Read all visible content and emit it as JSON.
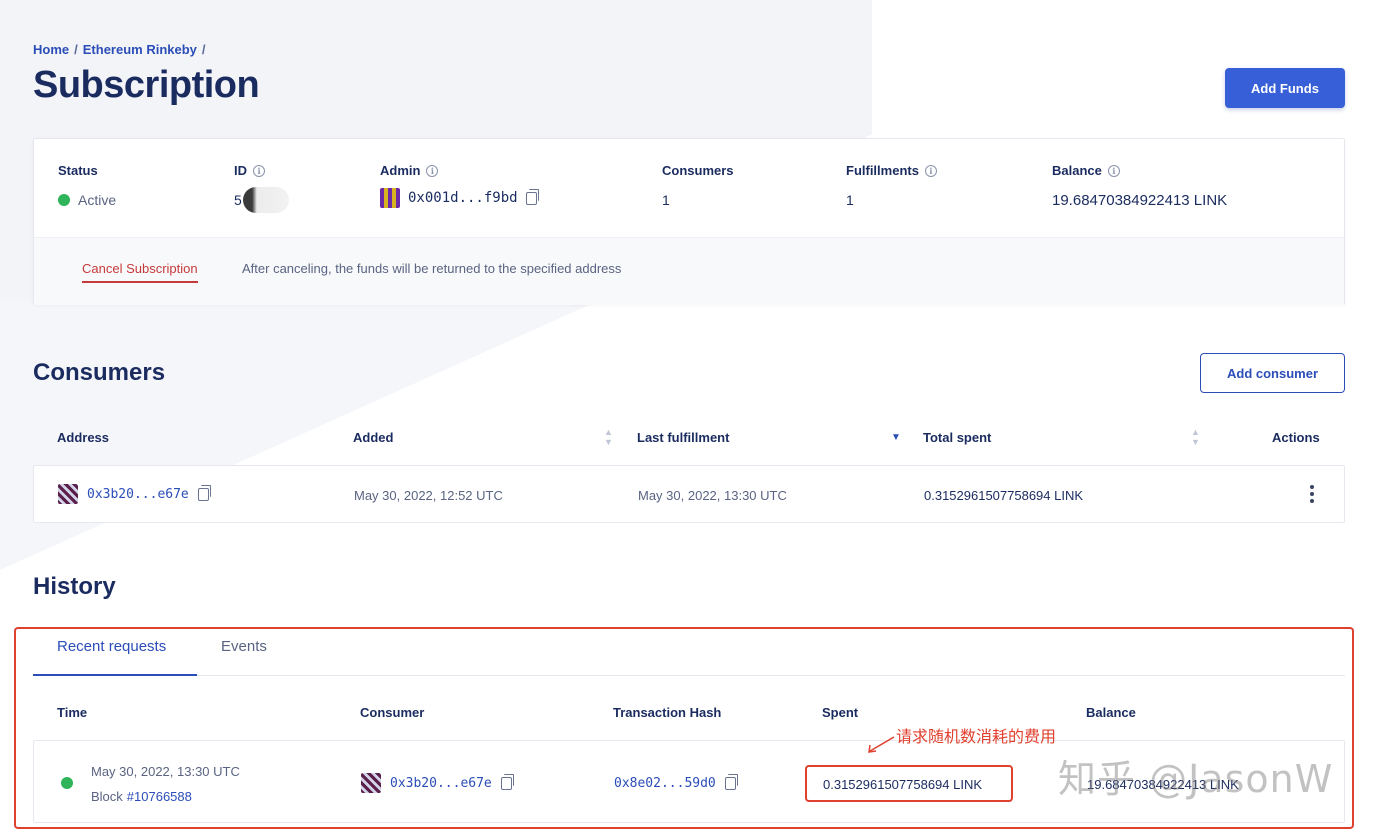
{
  "breadcrumb": {
    "home": "Home",
    "sep1": "/",
    "network": "Ethereum Rinkeby",
    "sep2": "/"
  },
  "page": {
    "title": "Subscription",
    "add_funds_label": "Add Funds"
  },
  "summary": {
    "status_label": "Status",
    "status_value": "Active",
    "id_label": "ID",
    "id_value": "5",
    "admin_label": "Admin",
    "admin_value": "0x001d...f9bd",
    "consumers_label": "Consumers",
    "consumers_value": "1",
    "fulfillments_label": "Fulfillments",
    "fulfillments_value": "1",
    "balance_label": "Balance",
    "balance_value": "19.68470384922413 LINK",
    "info_glyph": "i"
  },
  "cancel": {
    "label": "Cancel Subscription",
    "note": "After canceling, the funds will be returned to the specified address"
  },
  "consumers": {
    "title": "Consumers",
    "add_label": "Add consumer",
    "headers": {
      "address": "Address",
      "added": "Added",
      "last_fulfillment": "Last fulfillment",
      "total_spent": "Total spent",
      "actions": "Actions"
    },
    "rows": [
      {
        "address": "0x3b20...e67e",
        "added": "May 30, 2022, 12:52 UTC",
        "last_fulfillment": "May 30, 2022, 13:30 UTC",
        "total_spent": "0.3152961507758694 LINK"
      }
    ]
  },
  "history": {
    "title": "History",
    "tabs": {
      "recent": "Recent requests",
      "events": "Events"
    },
    "headers": {
      "time": "Time",
      "consumer": "Consumer",
      "tx_hash": "Transaction Hash",
      "spent": "Spent",
      "balance": "Balance"
    },
    "rows": [
      {
        "time": "May 30, 2022, 13:30 UTC",
        "block_label": "Block",
        "block": "#10766588",
        "consumer": "0x3b20...e67e",
        "tx_hash": "0x8e02...59d0",
        "spent": "0.3152961507758694 LINK",
        "balance": "19.68470384922413 LINK"
      }
    ]
  },
  "annotation": {
    "text": "请求随机数消耗的费用",
    "color": "#e0402e"
  },
  "watermark": {
    "text": "知乎 @JasonW"
  },
  "colors": {
    "accent": "#3760d8",
    "link": "#2b4db8",
    "success": "#2fb45a",
    "danger": "#c63a3a"
  }
}
